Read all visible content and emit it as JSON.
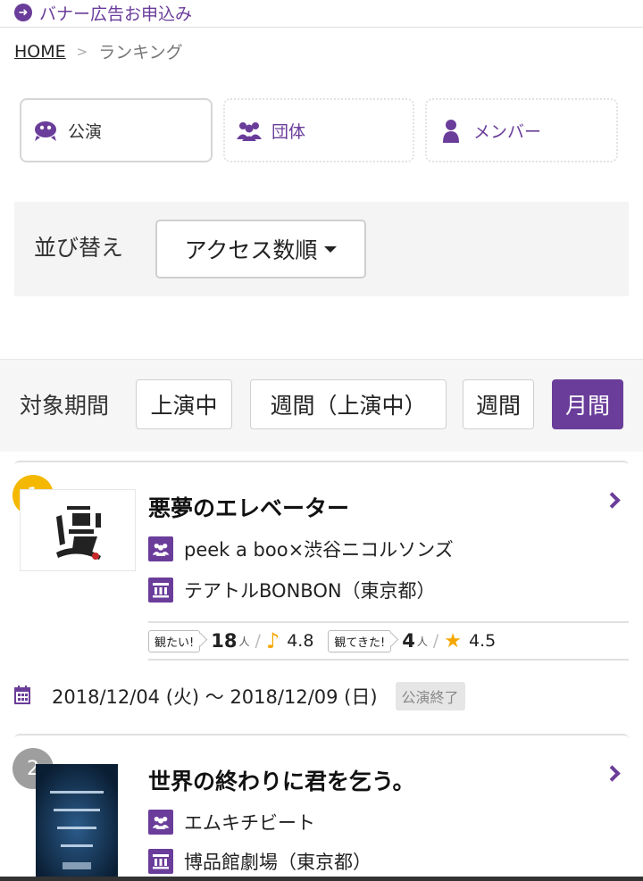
{
  "banner": {
    "label": "バナー広告お申込み"
  },
  "breadcrumb": {
    "home": "HOME",
    "separator": ">",
    "current": "ランキング"
  },
  "categories": [
    {
      "label": "公演",
      "icon": "play-mask-icon",
      "active": true
    },
    {
      "label": "団体",
      "icon": "group-icon",
      "active": false
    },
    {
      "label": "メンバー",
      "icon": "person-icon",
      "active": false
    }
  ],
  "sort": {
    "label": "並び替え",
    "selected": "アクセス数順"
  },
  "period": {
    "label": "対象期間",
    "options": [
      {
        "label": "上演中",
        "active": false
      },
      {
        "label": "週間（上演中）",
        "active": false
      },
      {
        "label": "週間",
        "active": false
      },
      {
        "label": "月間",
        "active": true
      }
    ]
  },
  "ranking": [
    {
      "rank": "1",
      "title": "悪夢のエレベーター",
      "company": "peek a boo×渋谷ニコルソンズ",
      "venue": "テアトルBONBON（東京都）",
      "want_tag": "観たい!",
      "want_count": "18",
      "want_rating": "4.8",
      "seen_tag": "観てきた!",
      "seen_count": "4",
      "seen_rating": "4.5",
      "people_unit": "人",
      "period": "2018/12/04 (火) 〜 2018/12/09 (日)",
      "status": "公演終了"
    },
    {
      "rank": "2",
      "title": "世界の終わりに君を乞う。",
      "company": "エムキチビート",
      "venue": "博品館劇場（東京都）"
    }
  ],
  "colors": {
    "accent": "#6a3d9a",
    "gold": "#f5b800",
    "silver": "#9e9e9e"
  }
}
